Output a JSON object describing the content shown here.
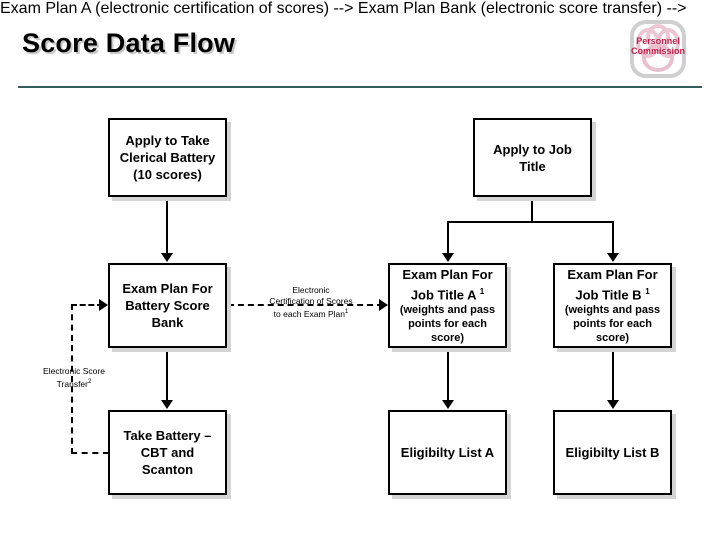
{
  "header": {
    "title": "Score Data Flow",
    "logo": {
      "line1": "Personnel",
      "line2": "Commission",
      "color": "#c31f4b",
      "frame_color": "#cfcfcf"
    },
    "rule_color": "#335c5c"
  },
  "diagram": {
    "type": "flowchart",
    "nodes": [
      {
        "id": "apply-battery",
        "line1": "Apply to Take",
        "line2": "Clerical Battery",
        "line3": "(10 scores)"
      },
      {
        "id": "apply-job-title",
        "line1": "Apply to Job",
        "line2": "Title"
      },
      {
        "id": "exam-plan-bank",
        "line1": "Exam Plan For",
        "line2": "Battery Score",
        "line3": "Bank"
      },
      {
        "id": "exam-plan-a",
        "line1": "Exam Plan For",
        "line2": "Job Title A",
        "superscript": "1",
        "detail1": "(weights and pass",
        "detail2": "points for each",
        "detail3": "score)"
      },
      {
        "id": "exam-plan-b",
        "line1": "Exam Plan For",
        "line2": "Job Title B",
        "superscript": "1",
        "detail1": "(weights and pass",
        "detail2": "points for each",
        "detail3": "score)"
      },
      {
        "id": "take-battery",
        "line1": "Take Battery –",
        "line2": "CBT and",
        "line3": "Scanton"
      },
      {
        "id": "eligibility-list-a",
        "line1": "Eligibilty List A"
      },
      {
        "id": "eligibility-list-b",
        "line1": "Eligibilty List B"
      }
    ],
    "edge_labels": [
      {
        "id": "certification",
        "line1": "Electronic",
        "line2": "Certification of Scores",
        "line3": "to each Exam Plan",
        "superscript": "1"
      },
      {
        "id": "score-transfer",
        "line1": "Electronic Score",
        "line2": "Transfer",
        "superscript": "2"
      }
    ]
  }
}
